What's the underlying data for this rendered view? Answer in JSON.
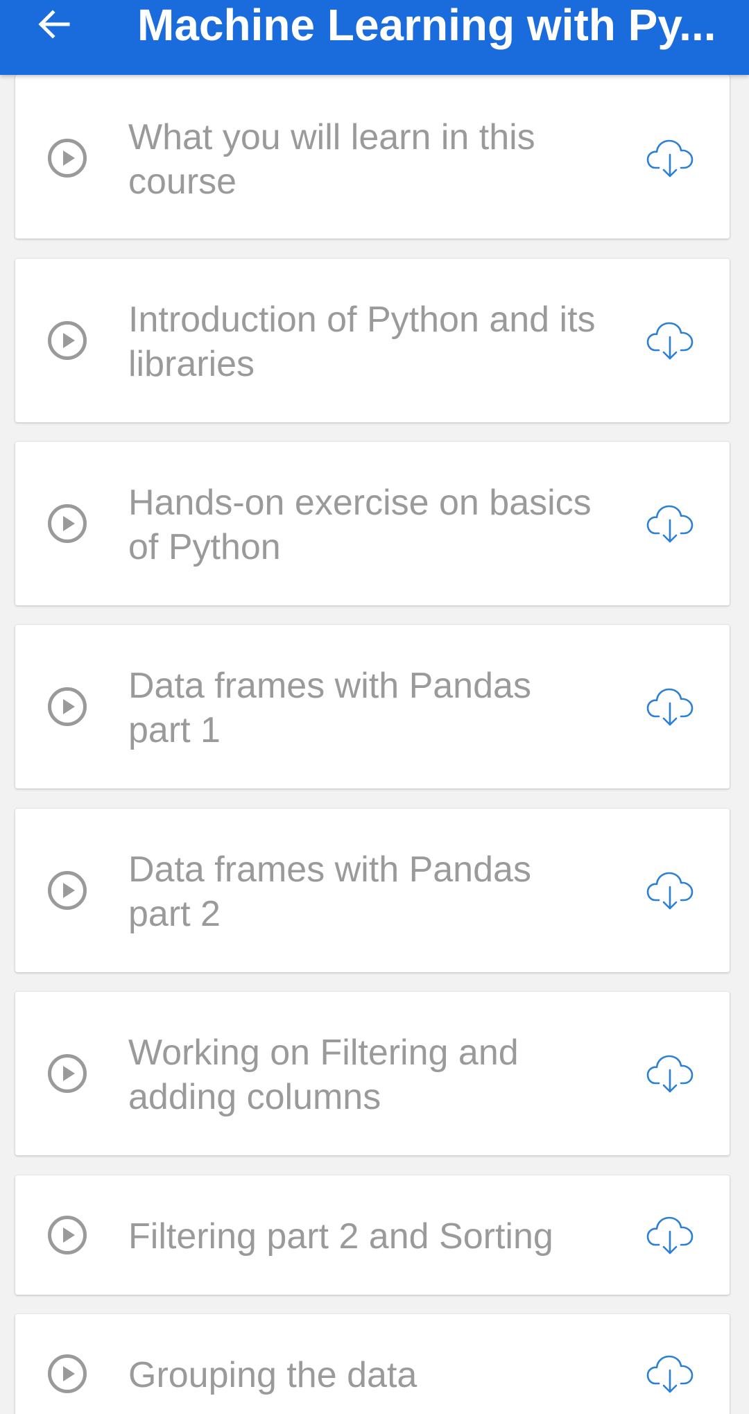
{
  "app_bar": {
    "title": "Machine Learning with Py...",
    "back_icon": "arrow-back-icon",
    "background_color": "#1a6cdc"
  },
  "lessons": [
    {
      "title": "What you will learn in this course"
    },
    {
      "title": "Introduction of Python and its libraries"
    },
    {
      "title": "Hands-on exercise on basics of Python"
    },
    {
      "title": "Data frames with Pandas part 1"
    },
    {
      "title": "Data frames with Pandas part 2"
    },
    {
      "title": "Working on Filtering and adding columns"
    },
    {
      "title": "Filtering part 2 and Sorting"
    },
    {
      "title": "Grouping the data"
    }
  ],
  "icons": {
    "play": "play-circle-icon",
    "download": "cloud-download-icon"
  },
  "colors": {
    "text_muted": "#9a9a9a",
    "icon_gray": "#9a9a9a",
    "download_blue": "#2b7fd6",
    "card_background": "#ffffff",
    "page_background": "#f2f2f2"
  }
}
